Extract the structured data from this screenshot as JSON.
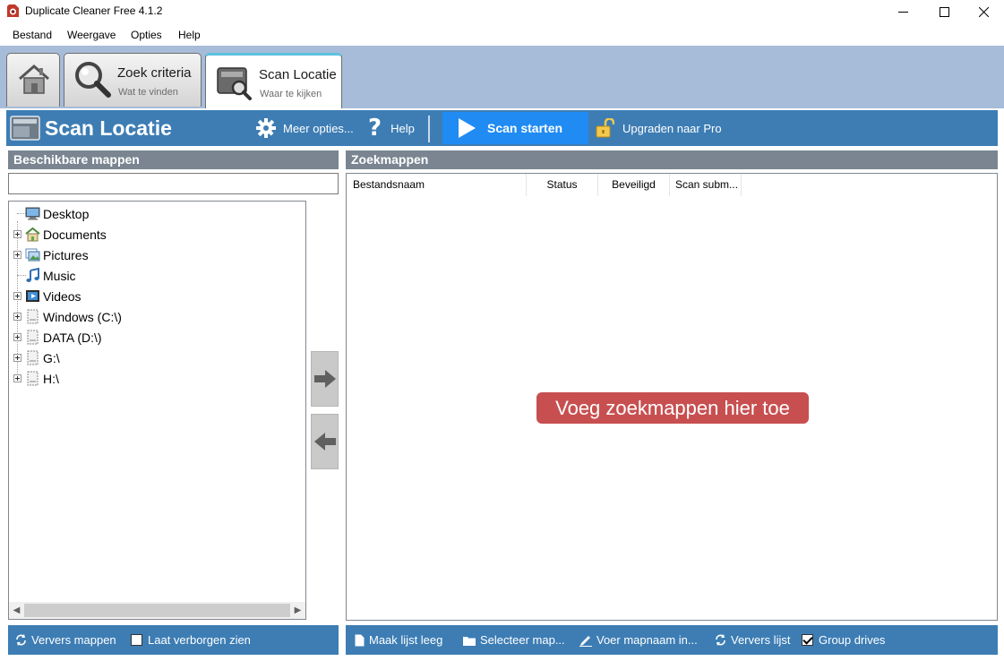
{
  "window": {
    "title": "Duplicate Cleaner Free 4.1.2",
    "minimize_icon": "minimize-icon",
    "maximize_icon": "maximize-icon",
    "close_icon": "close-icon"
  },
  "menu": {
    "items": [
      "Bestand",
      "Weergave",
      "Opties",
      "Help"
    ]
  },
  "tabs": [
    {
      "icon": "home-icon",
      "title": "",
      "subtitle": ""
    },
    {
      "icon": "magnifier-icon",
      "title": "Zoek criteria",
      "subtitle": "Wat te vinden"
    },
    {
      "icon": "scan-location-icon",
      "title": "Scan Locatie",
      "subtitle": "Waar te kijken",
      "active": true
    }
  ],
  "toolbar": {
    "title": "Scan Locatie",
    "more_options": "Meer opties...",
    "help": "Help",
    "scan_start": "Scan starten",
    "upgrade": "Upgraden naar Pro"
  },
  "left_pane": {
    "header": "Beschikbare mappen",
    "filter_value": "",
    "tree": [
      {
        "label": "Desktop",
        "icon": "desktop-icon",
        "expandable": false
      },
      {
        "label": "Documents",
        "icon": "documents-icon",
        "expandable": true
      },
      {
        "label": "Pictures",
        "icon": "pictures-icon",
        "expandable": true
      },
      {
        "label": "Music",
        "icon": "music-icon",
        "expandable": false
      },
      {
        "label": "Videos",
        "icon": "videos-icon",
        "expandable": true
      },
      {
        "label": "Windows (C:\\)",
        "icon": "drive-icon",
        "expandable": true
      },
      {
        "label": "DATA (D:\\)",
        "icon": "drive-icon",
        "expandable": true
      },
      {
        "label": "G:\\",
        "icon": "drive-icon",
        "expandable": true
      },
      {
        "label": "H:\\",
        "icon": "drive-icon",
        "expandable": true
      }
    ],
    "refresh_folders": "Ververs mappen",
    "show_hidden": "Laat verborgen zien",
    "show_hidden_checked": false
  },
  "right_pane": {
    "header": "Zoekmappen",
    "columns": [
      "Bestandsnaam",
      "Status",
      "Beveiligd",
      "Scan subm..."
    ],
    "empty_hint": "Voeg zoekmappen hier toe",
    "actions": {
      "clear_list": "Maak lijst leeg",
      "select_folder": "Selecteer map...",
      "enter_folder": "Voer mapnaam in...",
      "refresh_list": "Ververs lijst",
      "group_drives": "Group drives",
      "group_drives_checked": true
    }
  },
  "colors": {
    "toolbar_blue": "#3d7db4",
    "scan_button_blue": "#1f8bf3",
    "section_header_gray": "#7a8591",
    "tabstrip_bg": "#a6bcd8",
    "empty_hint_red": "#c84f50",
    "active_tab_accent": "#5cc1e0"
  }
}
